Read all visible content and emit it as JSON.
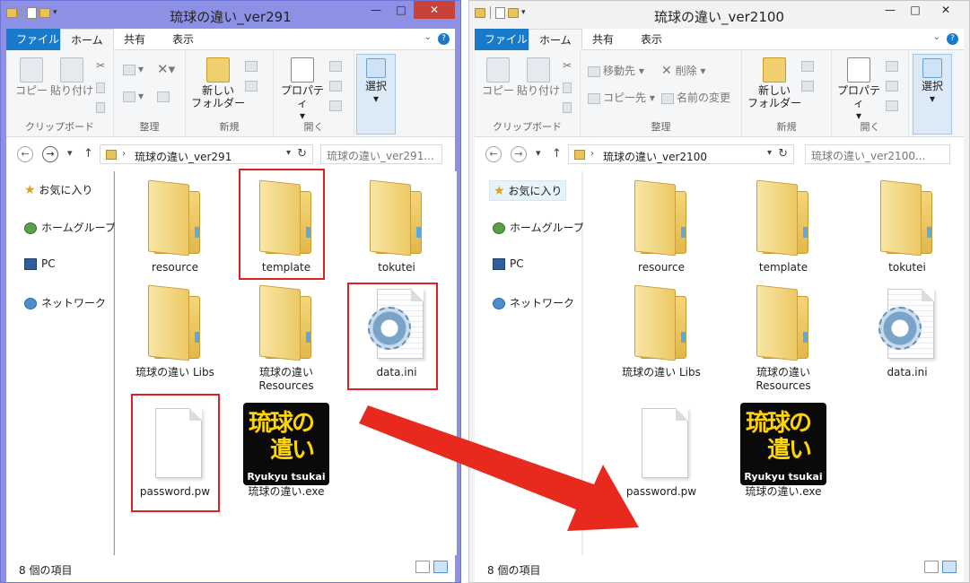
{
  "left": {
    "title": "琉球の違い_ver291",
    "tabs": [
      "ファイル",
      "ホーム",
      "共有",
      "表示"
    ],
    "ribbon": {
      "copy": "コピー",
      "paste": "貼り付け",
      "new_folder_line1": "新しい",
      "new_folder_line2": "フォルダー",
      "properties": "プロパティ",
      "select": "選択",
      "groups": [
        "クリップボード",
        "整理",
        "新規",
        "開く"
      ]
    },
    "address": "琉球の違い_ver291",
    "search_placeholder": "琉球の違い_ver291...",
    "nav": [
      "お気に入り",
      "ホームグループ",
      "PC",
      "ネットワーク"
    ],
    "items": [
      {
        "name": "resource",
        "type": "folder"
      },
      {
        "name": "template",
        "type": "folder"
      },
      {
        "name": "tokutei",
        "type": "folder"
      },
      {
        "name": "琉球の違い Libs",
        "type": "folder"
      },
      {
        "name": "琉球の違い",
        "name2": "Resources",
        "type": "folder"
      },
      {
        "name": "data.ini",
        "type": "ini"
      },
      {
        "name": "password.pw",
        "type": "file"
      },
      {
        "name": "琉球の違い.exe",
        "type": "exe"
      }
    ],
    "status": "8 個の項目"
  },
  "right": {
    "title": "琉球の違い_ver2100",
    "tabs": [
      "ファイル",
      "ホーム",
      "共有",
      "表示"
    ],
    "ribbon": {
      "copy": "コピー",
      "paste": "貼り付け",
      "move_to": "移動先",
      "copy_to": "コピー先",
      "delete": "削除",
      "rename": "名前の変更",
      "new_folder_line1": "新しい",
      "new_folder_line2": "フォルダー",
      "properties": "プロパティ",
      "select": "選択",
      "groups": [
        "クリップボード",
        "整理",
        "新規",
        "開く"
      ]
    },
    "address": "琉球の違い_ver2100",
    "search_placeholder": "琉球の違い_ver2100...",
    "nav": [
      "お気に入り",
      "ホームグループ",
      "PC",
      "ネットワーク"
    ],
    "items": [
      {
        "name": "resource",
        "type": "folder"
      },
      {
        "name": "template",
        "type": "folder"
      },
      {
        "name": "tokutei",
        "type": "folder"
      },
      {
        "name": "琉球の違い Libs",
        "type": "folder"
      },
      {
        "name": "琉球の違い",
        "name2": "Resources",
        "type": "folder"
      },
      {
        "name": "data.ini",
        "type": "ini"
      },
      {
        "name": "password.pw",
        "type": "file"
      },
      {
        "name": "琉球の違い.exe",
        "type": "exe"
      }
    ],
    "status": "8 個の項目"
  },
  "exe_icon": {
    "line1": "琉球の",
    "line2": "遣い",
    "caption": "Ryukyu tsukai"
  },
  "annotation": {
    "highlight_color": "#e02020",
    "arrow_color": "#e82a1e"
  }
}
